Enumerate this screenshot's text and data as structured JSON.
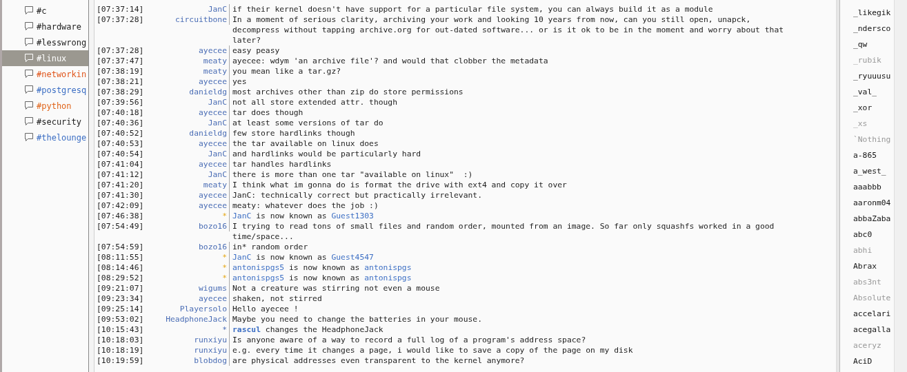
{
  "channels": [
    {
      "name": "#c",
      "selected": false,
      "color": "#222222"
    },
    {
      "name": "#hardware",
      "selected": false,
      "color": "#222222"
    },
    {
      "name": "#lesswrong",
      "selected": false,
      "color": "#222222"
    },
    {
      "name": "#linux",
      "selected": true,
      "color": "#ffffff"
    },
    {
      "name": "#networkin",
      "selected": false,
      "color": "#e0561c"
    },
    {
      "name": "#postgresq",
      "selected": false,
      "color": "#3d6fc4"
    },
    {
      "name": "#python",
      "selected": false,
      "color": "#e0661c"
    },
    {
      "name": "#security",
      "selected": false,
      "color": "#222222"
    },
    {
      "name": "#thelounge",
      "selected": false,
      "color": "#3d6fc4"
    }
  ],
  "messages": [
    {
      "kind": "message",
      "time": "[07:37:14]",
      "nick": "JanC",
      "text": "if their kernel doesn't have support for a particular file system, you can always build it as a module"
    },
    {
      "kind": "message",
      "time": "[07:37:28]",
      "nick": "circuitbone",
      "text": "In a moment of serious clarity, archiving your work and looking 10 years from now, can you still open, unapck, decompress without tapping archive.org for out-dated software... or is it ok to be in the moment and worry about that later?"
    },
    {
      "kind": "message",
      "time": "[07:37:28]",
      "nick": "ayecee",
      "text": "easy peasy"
    },
    {
      "kind": "message",
      "time": "[07:37:47]",
      "nick": "meaty",
      "text": "ayecee: wdym 'an archive file'? and would that clobber the metadata"
    },
    {
      "kind": "message",
      "time": "[07:38:19]",
      "nick": "meaty",
      "text": "you mean like a tar.gz?"
    },
    {
      "kind": "message",
      "time": "[07:38:21]",
      "nick": "ayecee",
      "text": "yes"
    },
    {
      "kind": "message",
      "time": "[07:38:29]",
      "nick": "danieldg",
      "text": "most archives other than zip do store permissions"
    },
    {
      "kind": "message",
      "time": "[07:39:56]",
      "nick": "JanC",
      "text": "not all store extended attr. though"
    },
    {
      "kind": "message",
      "time": "[07:40:18]",
      "nick": "ayecee",
      "text": "tar does though"
    },
    {
      "kind": "message",
      "time": "[07:40:36]",
      "nick": "JanC",
      "text": "at least some versions of tar do"
    },
    {
      "kind": "message",
      "time": "[07:40:52]",
      "nick": "danieldg",
      "text": "few store hardlinks though"
    },
    {
      "kind": "message",
      "time": "[07:40:53]",
      "nick": "ayecee",
      "text": "the tar available on linux does"
    },
    {
      "kind": "message",
      "time": "[07:40:54]",
      "nick": "JanC",
      "text": "and hardlinks would be particularly hard"
    },
    {
      "kind": "message",
      "time": "[07:41:04]",
      "nick": "ayecee",
      "text": "tar handles hardlinks"
    },
    {
      "kind": "message",
      "time": "[07:41:12]",
      "nick": "JanC",
      "text": "there is more than one tar \"available on linux\"  :)"
    },
    {
      "kind": "message",
      "time": "[07:41:20]",
      "nick": "meaty",
      "text": "I think what im gonna do is format the drive with ext4 and copy it over"
    },
    {
      "kind": "message",
      "time": "[07:41:30]",
      "nick": "ayecee",
      "text": "JanC: technically correct but practically irrelevant."
    },
    {
      "kind": "message",
      "time": "[07:42:09]",
      "nick": "ayecee",
      "text": "meaty: whatever does the job :)"
    },
    {
      "kind": "nick_change",
      "time": "[07:46:38]",
      "star": "*",
      "old": "JanC",
      "text": "is now known as",
      "new": "Guest1303"
    },
    {
      "kind": "message",
      "time": "[07:54:49]",
      "nick": "bozo16",
      "text": "I trying to read tons of small files and random order, mounted from an image. So far only squashfs worked in a good time/space..."
    },
    {
      "kind": "message",
      "time": "[07:54:59]",
      "nick": "bozo16",
      "text": "in* random order"
    },
    {
      "kind": "nick_change",
      "time": "[08:11:55]",
      "star": "*",
      "old": "JanC",
      "text": "is now known as",
      "new": "Guest4547"
    },
    {
      "kind": "nick_change",
      "time": "[08:14:46]",
      "star": "*",
      "old": "antonispgs5",
      "text": "is now known as",
      "new": "antonispgs"
    },
    {
      "kind": "nick_change",
      "time": "[08:29:52]",
      "star": "*",
      "old": "antonispgs5",
      "text": "is now known as",
      "new": "antonispgs"
    },
    {
      "kind": "message",
      "time": "[09:21:07]",
      "nick": "wigums",
      "text": "Not a creature was stirring not even a mouse"
    },
    {
      "kind": "message",
      "time": "[09:23:34]",
      "nick": "ayecee",
      "text": "shaken, not stirred"
    },
    {
      "kind": "message",
      "time": "[09:25:14]",
      "nick": "Playersolo",
      "text": "Hello ayecee !"
    },
    {
      "kind": "message",
      "time": "[09:53:02]",
      "nick": "HeadphoneJack",
      "text": "Maybe you need to change the batteries in your mouse."
    },
    {
      "kind": "action",
      "time": "[10:15:43]",
      "star": "*",
      "actor": "rascul",
      "text": "changes the HeadphoneJack"
    },
    {
      "kind": "message",
      "time": "[10:18:03]",
      "nick": "runxiyu",
      "text": "Is anyone aware of a way to record a full log of a program's address space?"
    },
    {
      "kind": "message",
      "time": "[10:18:19]",
      "nick": "runxiyu",
      "text": "e.g. every time it changes a page, i would like to save a copy of the page on my disk"
    },
    {
      "kind": "message",
      "time": "[10:19:59]",
      "nick": "blobdog",
      "text": "are physical addresses even transparent to the kernel anymore?"
    }
  ],
  "users": [
    {
      "name": "_likegik",
      "away": false
    },
    {
      "name": "_ndersco",
      "away": false
    },
    {
      "name": "_qw",
      "away": false
    },
    {
      "name": "_rubik",
      "away": true
    },
    {
      "name": "_ryuuusu",
      "away": false
    },
    {
      "name": "_val_",
      "away": false
    },
    {
      "name": "_xor",
      "away": false
    },
    {
      "name": "_xs",
      "away": true
    },
    {
      "name": "`Nothing",
      "away": true
    },
    {
      "name": "a-865",
      "away": false
    },
    {
      "name": "a_west_",
      "away": false
    },
    {
      "name": "aaabbb",
      "away": false
    },
    {
      "name": "aaronm04",
      "away": false
    },
    {
      "name": "abbaZaba",
      "away": false
    },
    {
      "name": "abc0",
      "away": false
    },
    {
      "name": "abhi",
      "away": true
    },
    {
      "name": "Abrax",
      "away": false
    },
    {
      "name": "abs3nt",
      "away": true
    },
    {
      "name": "Absolute",
      "away": true
    },
    {
      "name": "accelari",
      "away": false
    },
    {
      "name": "acegalla",
      "away": false
    },
    {
      "name": "aceryz",
      "away": true
    },
    {
      "name": "AciD",
      "away": false
    }
  ]
}
